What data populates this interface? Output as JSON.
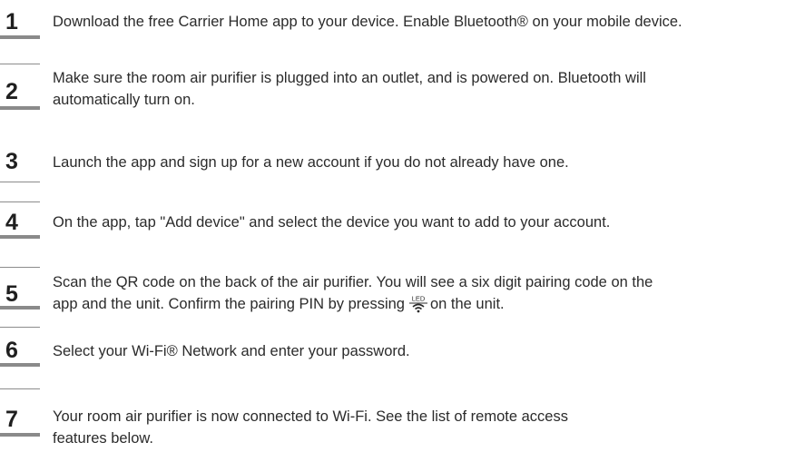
{
  "steps": [
    {
      "number": "1",
      "line1": "Download the free Carrier Home app to your device. Enable Bluetooth® on your mobile device."
    },
    {
      "number": "2",
      "line1": "Make sure the room air purifier is plugged into an outlet, and is powered on. Bluetooth will",
      "line2": "automatically turn on."
    },
    {
      "number": "3",
      "line1": "Launch the app and sign up for a new account if you do not already have one."
    },
    {
      "number": "4",
      "line1": "On the app, tap \"Add device\" and select the device you want to add to your account."
    },
    {
      "number": "5",
      "line1": "Scan the QR code on the back of the air purifier. You will see a six digit pairing code on the",
      "line2_before": "app and the unit. Confirm the pairing PIN by pressing",
      "line2_after": "on the unit.",
      "icon_label": "LED",
      "icon": "led-wifi-icon"
    },
    {
      "number": "6",
      "line1": "Select your Wi-Fi® Network and enter your password."
    },
    {
      "number": "7",
      "line1": "Your room air purifier is now connected to Wi-Fi. See the list of remote access",
      "line2": "features below."
    }
  ]
}
